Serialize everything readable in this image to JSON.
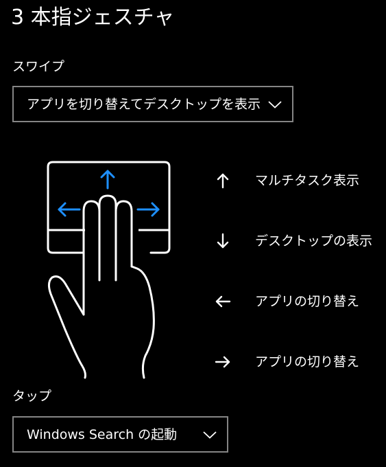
{
  "page": {
    "title": "3 本指ジェスチャ",
    "background": "#000000",
    "text_color": "#ffffff",
    "accent": "#1e90ff",
    "border_color": "#858585"
  },
  "swipe": {
    "label": "スワイプ",
    "dropdown_value": "アプリを切り替えてデスクトップを表示",
    "chevron_icon": "chevron-down-icon"
  },
  "illustration": {
    "icon": "three-finger-touchpad-icon"
  },
  "gestures": [
    {
      "direction": "up",
      "icon": "arrow-up-icon",
      "label": "マルチタスク表示"
    },
    {
      "direction": "down",
      "icon": "arrow-down-icon",
      "label": "デスクトップの表示"
    },
    {
      "direction": "left",
      "icon": "arrow-left-icon",
      "label": "アプリの切り替え"
    },
    {
      "direction": "right",
      "icon": "arrow-right-icon",
      "label": "アプリの切り替え"
    }
  ],
  "tap": {
    "label": "タップ",
    "dropdown_value": "Windows Search の起動",
    "chevron_icon": "chevron-down-icon"
  }
}
